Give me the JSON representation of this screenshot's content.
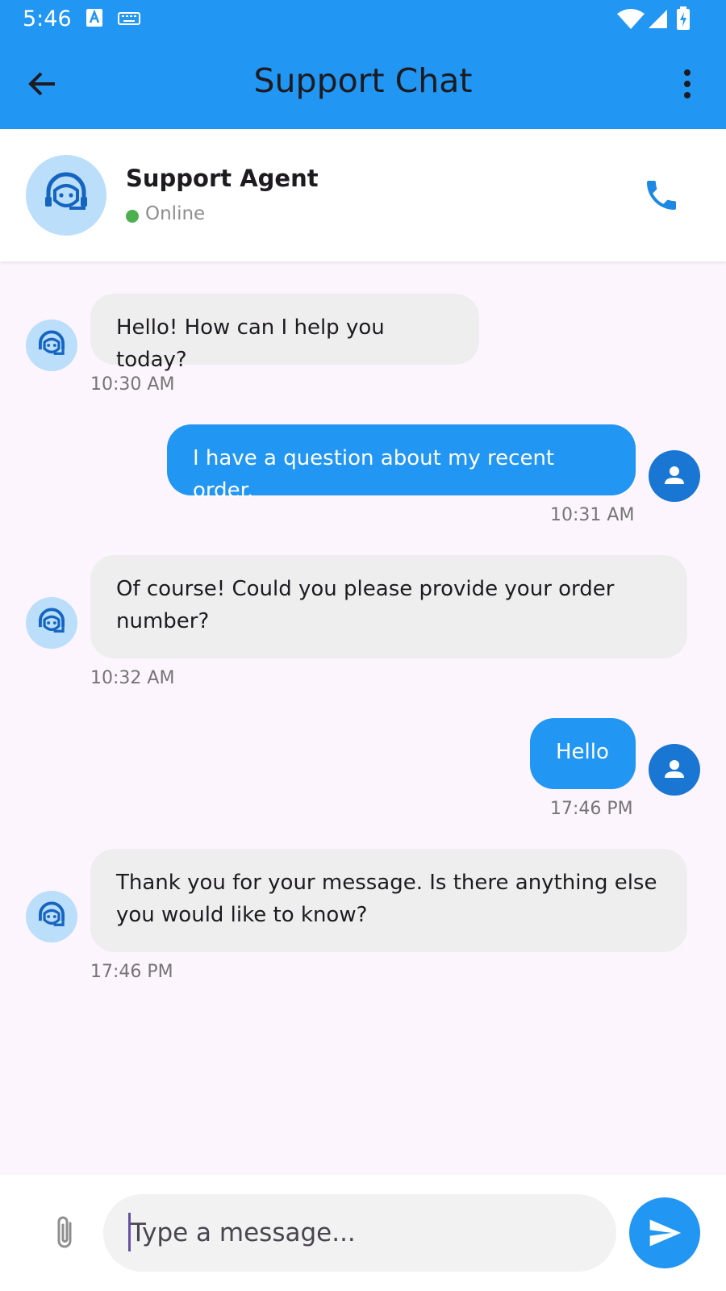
{
  "status_bar": {
    "time": "5:46"
  },
  "app_bar": {
    "title": "Support Chat"
  },
  "agent": {
    "name": "Support Agent",
    "status": "Online"
  },
  "messages": [
    {
      "sender": "agent",
      "text": "Hello! How can I help you today?",
      "time": "10:30 AM"
    },
    {
      "sender": "user",
      "text": "I have a question about my recent order.",
      "time": "10:31 AM"
    },
    {
      "sender": "agent",
      "text": "Of course! Could you please provide your order number?",
      "time": "10:32 AM"
    },
    {
      "sender": "user",
      "text": "Hello",
      "time": "17:46 PM"
    },
    {
      "sender": "agent",
      "text": "Thank you for your message. Is there anything else you would like to know?",
      "time": "17:46 PM"
    }
  ],
  "composer": {
    "placeholder": "Type a message...",
    "value": ""
  },
  "colors": {
    "primary": "#2196f3",
    "user_avatar": "#1976d2",
    "agent_avatar_bg": "#bbdefb",
    "agent_bubble": "#eeeeee",
    "online": "#4caf50"
  }
}
